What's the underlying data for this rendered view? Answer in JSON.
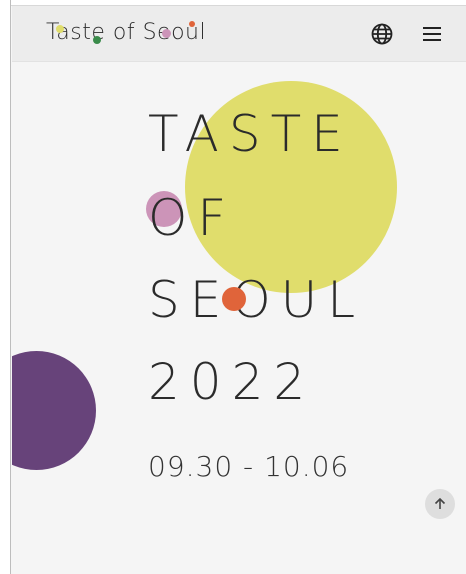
{
  "header": {
    "logo_text": "Taste of Seoul",
    "globe_icon": "globe-icon",
    "menu_icon": "hamburger-menu-icon"
  },
  "hero": {
    "title_lines": [
      "TASTE",
      "OF",
      "SEOUL",
      "2022"
    ],
    "dates": "09.30 - 10.06"
  },
  "scroll_top_icon": "arrow-up-icon",
  "colors": {
    "yellow": "#e0dd6c",
    "pink": "#cc94b8",
    "orange": "#e0643a",
    "purple": "#67437a",
    "green": "#3a8b4a",
    "text": "#2b2b2b",
    "background": "#f5f5f5"
  }
}
